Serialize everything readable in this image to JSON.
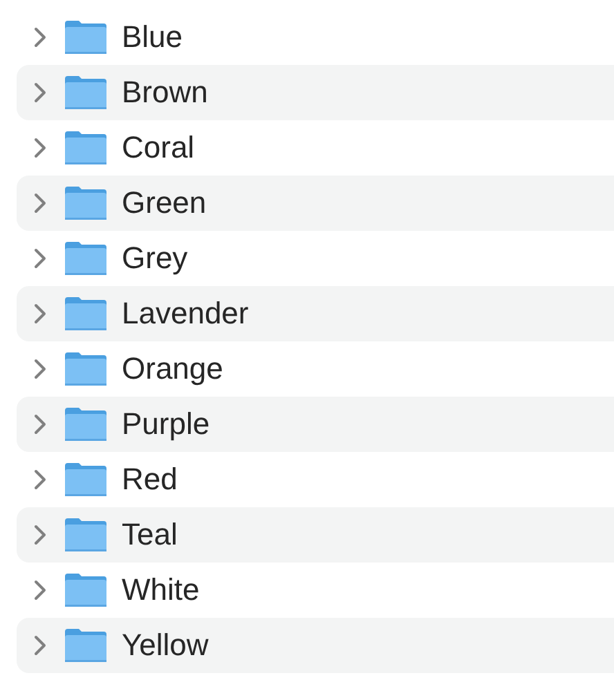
{
  "folders": [
    {
      "name": "Blue",
      "expanded": false
    },
    {
      "name": "Brown",
      "expanded": false
    },
    {
      "name": "Coral",
      "expanded": false
    },
    {
      "name": "Green",
      "expanded": false
    },
    {
      "name": "Grey",
      "expanded": false
    },
    {
      "name": "Lavender",
      "expanded": false
    },
    {
      "name": "Orange",
      "expanded": false
    },
    {
      "name": "Purple",
      "expanded": false
    },
    {
      "name": "Red",
      "expanded": false
    },
    {
      "name": "Teal",
      "expanded": false
    },
    {
      "name": "White",
      "expanded": false
    },
    {
      "name": "Yellow",
      "expanded": false
    }
  ]
}
